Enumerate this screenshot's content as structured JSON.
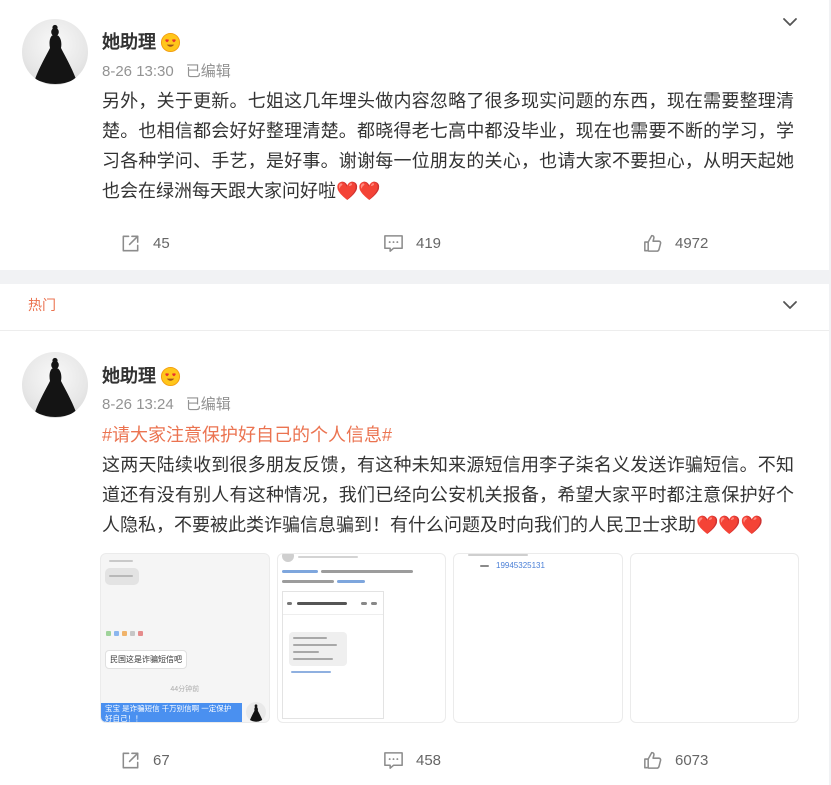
{
  "posts": [
    {
      "author": "她助理",
      "time": "8-26 13:30",
      "edited": "已编辑",
      "text": "另外，关于更新。七姐这几年埋头做内容忽略了很多现实问题的东西，现在需要整理清楚。也相信都会好好整理清楚。都晓得老七高中都没毕业，现在也需要不断的学习，学习各种学问、手艺，是好事。谢谢每一位朋友的关心，也请大家不要担心，从明天起她也会在绿洲每天跟大家问好啦",
      "emoji": "❤️❤️",
      "actions": {
        "share": "45",
        "comment": "419",
        "like": "4972"
      }
    },
    {
      "section_label": "热门",
      "author": "她助理",
      "time": "8-26 13:24",
      "edited": "已编辑",
      "topic": "#请大家注意保护好自己的个人信息#",
      "text": "这两天陆续收到很多朋友反馈，有这种未知来源短信用李子柒名义发送诈骗短信。不知道还有没有别人有这种情况，我们已经向公安机关报备，希望大家平时都注意保护好个人隐私，不要被此类诈骗信息骗到！有什么问题及时向我们的人民卫士求助",
      "emoji": "❤️❤️❤️",
      "images": [
        {
          "message": "民国这是诈骗短信吧",
          "time": "44分钟前",
          "reply": "宝宝 是诈骗短信 千万别信啊 一定保护好自己！！"
        },
        {},
        {
          "phone": "19945325131"
        },
        {}
      ],
      "actions": {
        "share": "67",
        "comment": "458",
        "like": "6073"
      }
    }
  ],
  "icons": {
    "menu": "chevron-down-icon",
    "badge": "fan-badge-icon",
    "share": "share-icon",
    "comment": "comment-icon",
    "like": "like-icon"
  },
  "colors": {
    "accent": "#eb7350",
    "text": "#333333",
    "meta": "#939393",
    "action": "#8c8c8c",
    "heart": "#f03b3b",
    "page_background": "#f1f2f4"
  }
}
